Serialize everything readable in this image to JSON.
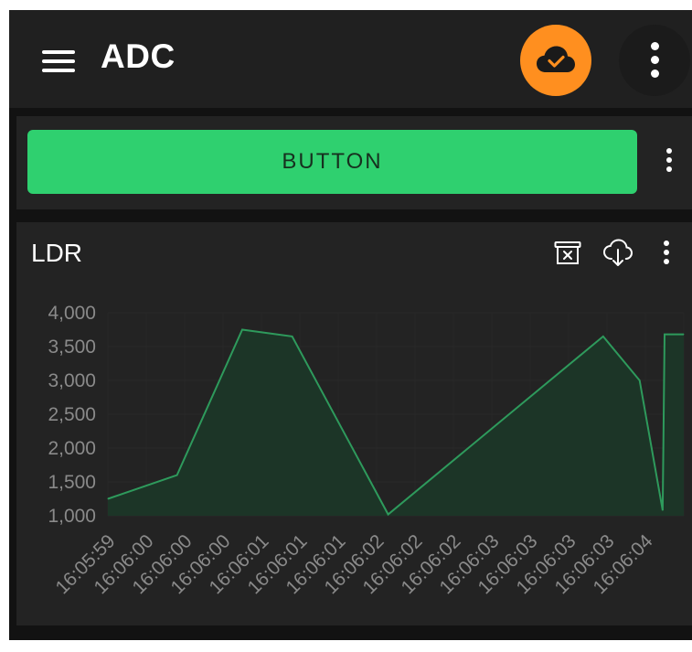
{
  "app": {
    "title": "ADC",
    "menu_icon": "hamburger-menu-icon",
    "cloud_icon": "cloud-check-icon",
    "cloud_color": "#ff8f1f",
    "overflow_icon": "more-vertical-icon"
  },
  "button_widget": {
    "label": "BUTTON",
    "color": "#2fd06f",
    "menu_icon": "more-vertical-icon"
  },
  "chart_widget": {
    "title": "LDR",
    "icons": [
      "clear-data-icon",
      "cloud-download-icon",
      "more-vertical-icon"
    ],
    "line_color": "#2e9a5c",
    "fill_color": "#1c3527"
  },
  "chart_data": {
    "type": "area",
    "title": "LDR",
    "xlabel": "",
    "ylabel": "",
    "x_tick_labels": [
      "16:05:59",
      "16:06:00",
      "16:06:00",
      "16:06:00",
      "16:06:01",
      "16:06:01",
      "16:06:01",
      "16:06:02",
      "16:06:02",
      "16:06:02",
      "16:06:03",
      "16:06:03",
      "16:06:03",
      "16:06:03",
      "16:06:04"
    ],
    "y_ticks": [
      4000,
      3500,
      3000,
      2500,
      2000,
      1500,
      1000
    ],
    "y_tick_labels": [
      "4,000",
      "3,500",
      "3,000",
      "2,500",
      "2,000",
      "1,500",
      "1,000"
    ],
    "ylim": [
      1000,
      4000
    ],
    "grid": true,
    "series": [
      {
        "values": [
          1250,
          1600,
          3750,
          3650,
          1020,
          3650,
          3000,
          1080,
          3680,
          3680
        ],
        "positions": [
          0,
          1.8,
          3.5,
          4.8,
          7.3,
          12.9,
          13.85,
          14.45,
          14.5,
          15.0
        ]
      }
    ]
  }
}
